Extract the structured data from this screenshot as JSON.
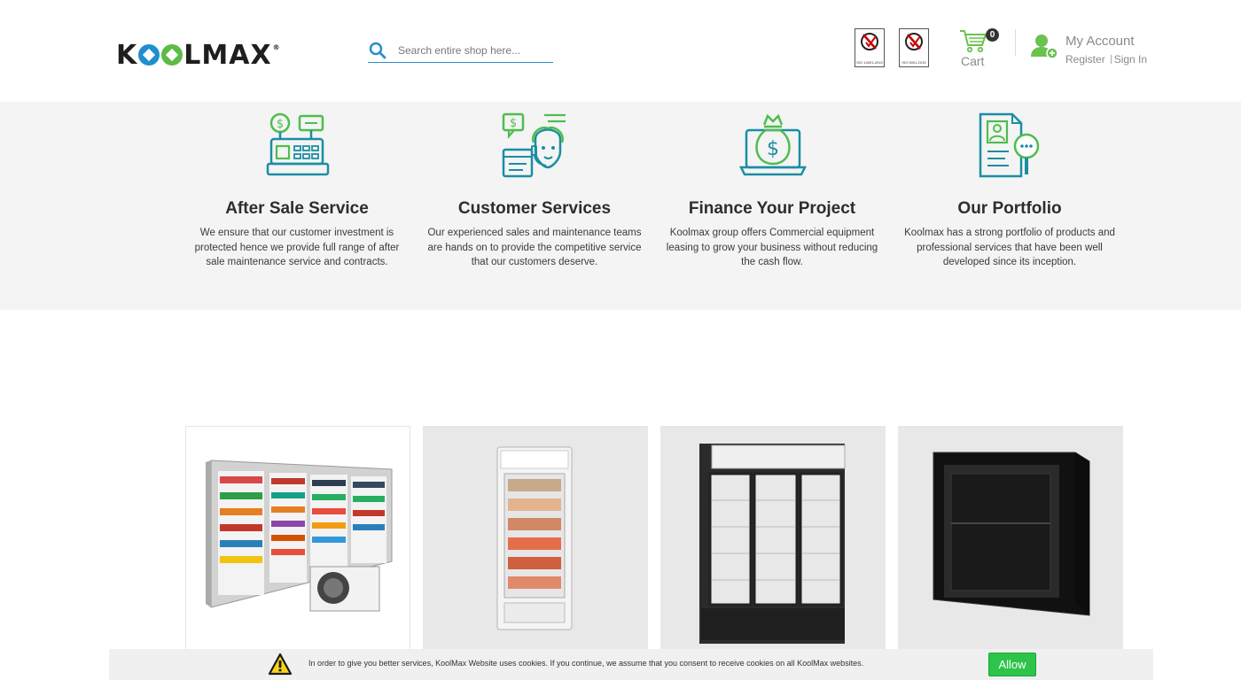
{
  "header": {
    "logo": {
      "text_left": "K",
      "text_right": "LMAX",
      "reg_mark": "®",
      "brand_colors": [
        "#1f8fd0",
        "#5dbb46"
      ]
    },
    "search": {
      "placeholder": "Search entire shop here...",
      "icon": "search-icon"
    },
    "certifications": [
      {
        "label": "ISO 14001-2015",
        "icon": "iso-cert-icon"
      },
      {
        "label": "ISO 9001-2015",
        "icon": "iso-cert-icon"
      }
    ],
    "cart": {
      "label": "Cart",
      "count": "0",
      "icon": "cart-icon"
    },
    "account": {
      "title": "My Account",
      "register": "Register",
      "sign_in": "Sign In",
      "icon": "user-add-icon"
    }
  },
  "services": [
    {
      "title": "After Sale Service",
      "description": "We ensure that our customer investment is protected hence we provide full range of after sale maintenance service and contracts.",
      "icon": "cash-register-icon"
    },
    {
      "title": "Customer Services",
      "description": "Our experienced sales and maintenance teams are hands on to provide the competitive service that our customers deserve.",
      "icon": "support-agent-icon"
    },
    {
      "title": "Finance Your Project",
      "description": "Koolmax group offers Commercial equipment leasing to grow your business without reducing the cash flow.",
      "icon": "money-bag-laptop-icon"
    },
    {
      "title": "Our Portfolio",
      "description": "Koolmax has a strong portfolio of products and professional services that have been well developed since its inception.",
      "icon": "portfolio-search-icon"
    }
  ],
  "products": [
    {
      "name": "multideck-display-chiller",
      "icon": "multideck-chiller-image"
    },
    {
      "name": "single-door-display-freezer",
      "icon": "upright-freezer-image"
    },
    {
      "name": "three-door-display-cooler",
      "icon": "three-door-cooler-image"
    },
    {
      "name": "mini-bar-fridge",
      "icon": "minibar-fridge-image"
    }
  ],
  "cookie_bar": {
    "text": "In order to give you better services, KoolMax Website uses cookies. If you continue, we assume that you consent to receive cookies on all KoolMax websites.",
    "button": "Allow",
    "icon": "warning-icon",
    "accent": "#2dc44a"
  },
  "colors": {
    "teal_icons": "#1a8ea3",
    "green_icons": "#4fbd4f",
    "accent_blue": "#2a8ecb"
  }
}
